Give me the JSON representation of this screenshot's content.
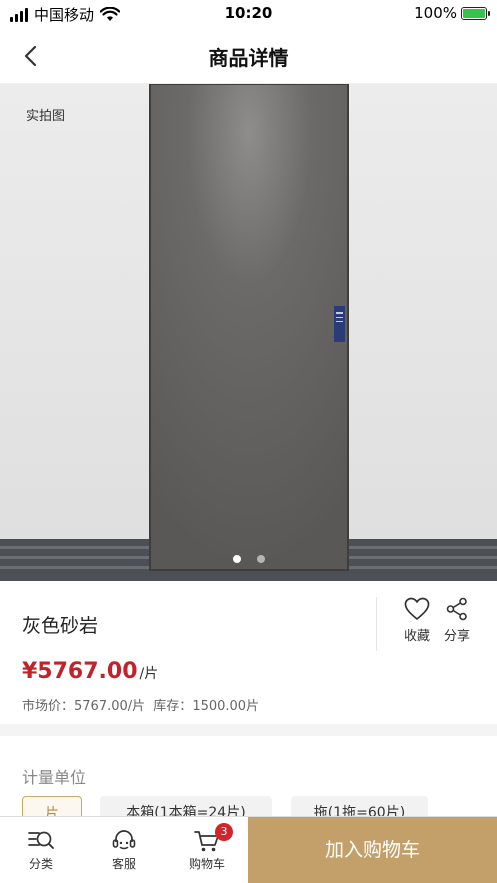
{
  "status_bar": {
    "carrier": "中国移动",
    "time": "10:20",
    "battery_percent": "100%",
    "battery_level": 1.0,
    "signal_bars": 4
  },
  "nav": {
    "title": "商品详情",
    "back_icon": "chevron-left-icon"
  },
  "gallery": {
    "tag": "实拍图",
    "image_count": 2,
    "active_index": 0,
    "colors": {
      "wall": "#e8e8e8",
      "door": "#6a6866",
      "floor": "#4a4d52"
    }
  },
  "product": {
    "name": "灰色砂岩",
    "price": "¥5767.00",
    "price_unit": "/片",
    "market_price_label": "市场价：",
    "market_price": "5767.00/片",
    "stock_label": "库存：",
    "stock": "1500.00片"
  },
  "actions": {
    "favorite": {
      "label": "收藏",
      "icon": "heart-icon"
    },
    "share": {
      "label": "分享",
      "icon": "share-icon"
    }
  },
  "unit_section": {
    "title": "计量单位",
    "options": [
      "片",
      "本箱(1本箱=24片)",
      "拖(1拖=60片)"
    ],
    "selected_index": 0
  },
  "bottom_bar": {
    "tabs": [
      {
        "label": "分类",
        "icon": "category-search-icon"
      },
      {
        "label": "客服",
        "icon": "customer-service-icon"
      },
      {
        "label": "购物车",
        "icon": "cart-icon"
      }
    ],
    "cart_badge": "3",
    "add_to_cart": "加入购物车"
  },
  "colors": {
    "accent": "#c3a06a",
    "price": "#c0232a",
    "badge": "#d0252c",
    "battery": "#39c24a"
  }
}
